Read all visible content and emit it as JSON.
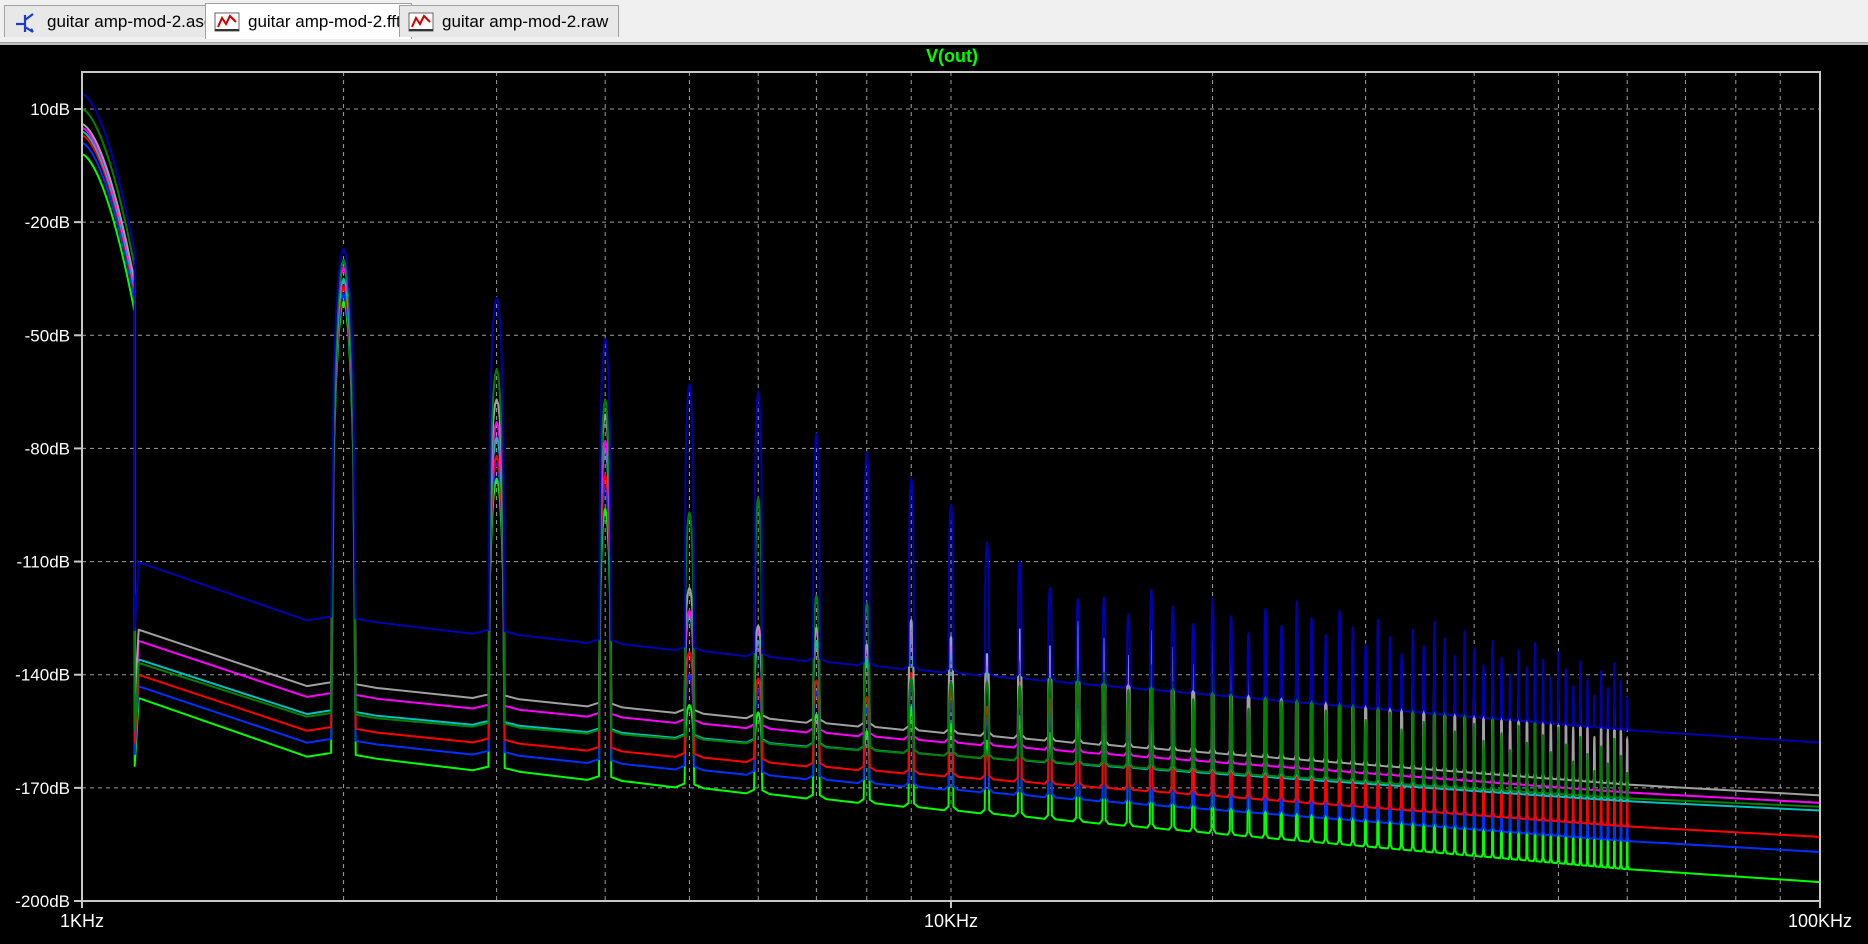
{
  "tabs": [
    {
      "label": "guitar amp-mod-2.asc",
      "icon": "schematic-icon",
      "active": false
    },
    {
      "label": "guitar amp-mod-2.fft",
      "icon": "waveform-icon",
      "active": true
    },
    {
      "label": "guitar amp-mod-2.raw",
      "icon": "waveform-icon",
      "active": false
    }
  ],
  "colors": {
    "background": "#000000",
    "grid": "#a0a0a0",
    "frame": "#c8c8c8",
    "axis_text": "#ffffff",
    "title": "#00ff00"
  },
  "chart_data": {
    "type": "line",
    "title": "V(out)",
    "xlabel": "",
    "ylabel": "",
    "xscale": "log",
    "xlim": [
      1000,
      100000
    ],
    "ylim": [
      -200,
      10
    ],
    "y_ticks": [
      10,
      -20,
      -50,
      -80,
      -110,
      -140,
      -170,
      -200
    ],
    "y_tick_labels": [
      "10dB",
      "-20dB",
      "-50dB",
      "-80dB",
      "-110dB",
      "-140dB",
      "-170dB",
      "-200dB"
    ],
    "x_tick_labels": [
      {
        "value": 1000,
        "label": "1KHz"
      },
      {
        "value": 10000,
        "label": "10KHz"
      },
      {
        "value": 100000,
        "label": "100KHz"
      }
    ],
    "grid": true,
    "fundamental_hz": 1000,
    "harmonic_count": 60,
    "series": [
      {
        "color": "#0000b0",
        "fundamental_db": 14,
        "harmonics_db": [
          -27,
          -40,
          -51,
          -63,
          -65,
          -76,
          -81,
          -88,
          -95,
          -105,
          -110,
          -117,
          -120
        ],
        "noise_db_start": -119,
        "noise_db_end": -158
      },
      {
        "color": "#008000",
        "fundamental_db": 10,
        "harmonics_db": [
          -30,
          -59,
          -67,
          -97,
          -93,
          -119,
          -121,
          -141,
          -142,
          -142,
          -143,
          -141,
          -140
        ],
        "noise_db_start": -146,
        "noise_db_end": -175
      },
      {
        "color": "#a0a0a0",
        "fundamental_db": 6,
        "harmonics_db": [
          -30,
          -67,
          -71,
          -117,
          -127
        ],
        "noise_db_start": -137,
        "noise_db_end": -172
      },
      {
        "color": "#ff00ff",
        "fundamental_db": 5,
        "harmonics_db": [
          -32,
          -73,
          -78,
          -123,
          -128
        ],
        "noise_db_start": -140,
        "noise_db_end": -174
      },
      {
        "color": "#00c0c0",
        "fundamental_db": 4,
        "harmonics_db": [
          -35,
          -77,
          -80,
          -124,
          -131
        ],
        "noise_db_start": -145,
        "noise_db_end": -176
      },
      {
        "color": "#ff0000",
        "fundamental_db": 3,
        "harmonics_db": [
          -37,
          -82,
          -87,
          -134,
          -141
        ],
        "noise_db_start": -149,
        "noise_db_end": -183
      },
      {
        "color": "#0030ff",
        "fundamental_db": 1,
        "harmonics_db": [
          -39,
          -84,
          -90,
          -140,
          -144
        ],
        "noise_db_start": -152,
        "noise_db_end": -187
      },
      {
        "color": "#00ff00",
        "fundamental_db": -2,
        "harmonics_db": [
          -41,
          -88,
          -96,
          -148,
          -150
        ],
        "noise_db_start": -155,
        "noise_db_end": -195
      }
    ]
  }
}
